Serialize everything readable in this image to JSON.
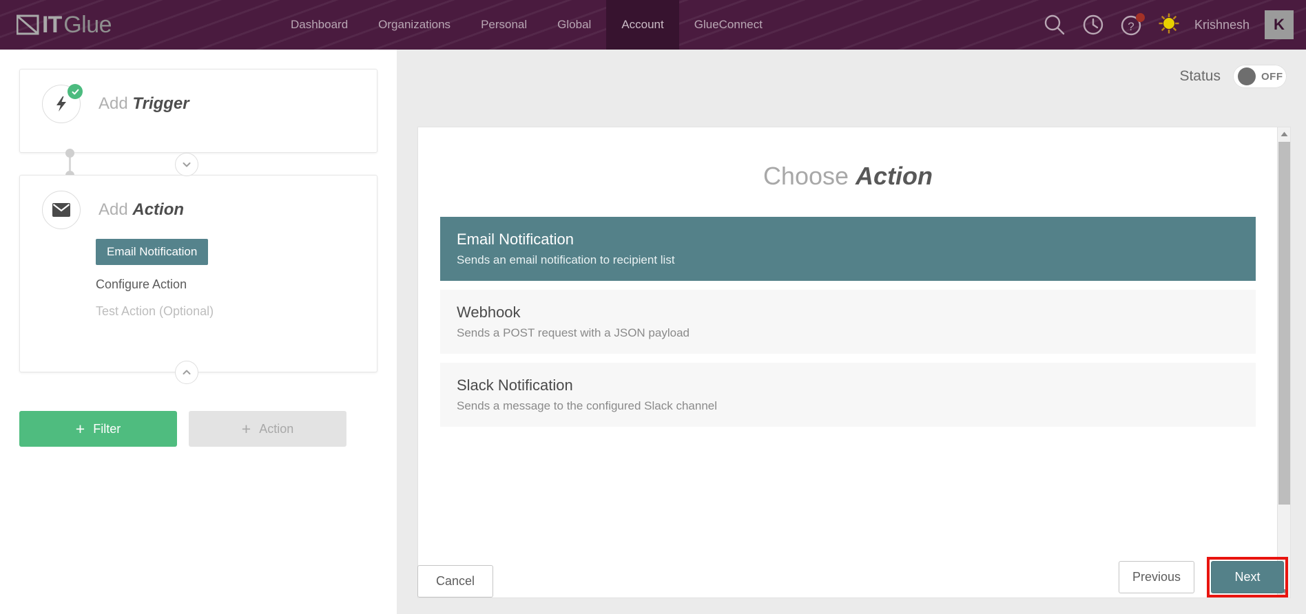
{
  "header": {
    "logo": {
      "mark": "itglue-diagonal-mark",
      "it": "IT",
      "glue": "Glue"
    },
    "nav": [
      {
        "label": "Dashboard",
        "active": false
      },
      {
        "label": "Organizations",
        "active": false
      },
      {
        "label": "Personal",
        "active": false
      },
      {
        "label": "Global",
        "active": false
      },
      {
        "label": "Account",
        "active": true
      },
      {
        "label": "GlueConnect",
        "active": false
      }
    ],
    "icons": [
      {
        "name": "search-icon"
      },
      {
        "name": "clock-history-icon"
      },
      {
        "name": "help-icon",
        "has_badge": true
      }
    ],
    "user": {
      "name": "Krishnesh",
      "avatar": "sun-avatar-icon"
    },
    "badge": {
      "label": "K"
    }
  },
  "workflow": {
    "trigger": {
      "icon": "lightning-bolt-icon",
      "status": "complete",
      "title_light": "Add",
      "title_bold": "Trigger"
    },
    "action": {
      "icon": "envelope-icon",
      "title_light": "Add",
      "title_bold": "Action",
      "steps": [
        {
          "label": "Email Notification",
          "state": "selected"
        },
        {
          "label": "Configure Action",
          "state": "normal"
        },
        {
          "label": "Test Action (Optional)",
          "state": "muted"
        }
      ]
    },
    "buttons": {
      "filter": {
        "label": "Filter",
        "plus": "+",
        "enabled": true
      },
      "action": {
        "label": "Action",
        "plus": "+",
        "enabled": false
      }
    },
    "chevron_down": "chevron-down-icon",
    "chevron_up": "chevron-up-icon"
  },
  "status": {
    "label": "Status",
    "value": "OFF",
    "on": false
  },
  "main": {
    "title_light": "Choose",
    "title_bold": "Action",
    "options": [
      {
        "name": "Email Notification",
        "desc": "Sends an email notification to recipient list",
        "selected": true
      },
      {
        "name": "Webhook",
        "desc": "Sends a POST request with a JSON payload",
        "selected": false
      },
      {
        "name": "Slack Notification",
        "desc": "Sends a message to the configured Slack channel",
        "selected": false
      }
    ]
  },
  "footer": {
    "cancel": "Cancel",
    "previous": "Previous",
    "next": "Next"
  },
  "colors": {
    "header_purple": "#4a1b3f",
    "nav_active_purple": "#37132f",
    "teal": "#548189",
    "green": "#4fbc7f",
    "highlight_red": "#e8140f"
  }
}
